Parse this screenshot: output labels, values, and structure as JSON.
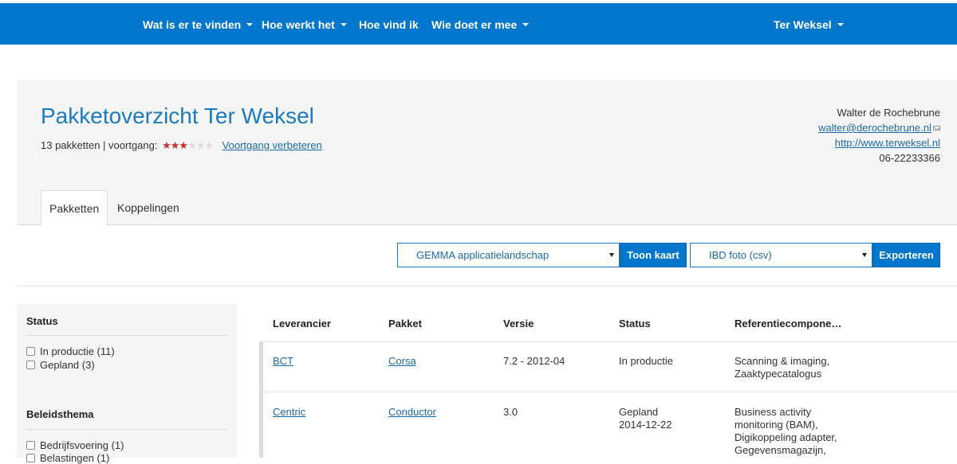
{
  "nav": {
    "items": [
      "Wat is er te vinden",
      "Hoe werkt het",
      "Hoe vind ik",
      "Wie doet er mee"
    ],
    "user_menu": "Ter Weksel"
  },
  "header": {
    "title": "Pakketoverzicht Ter Weksel",
    "summary": "13 pakketten | voortgang:",
    "progress_stars": {
      "filled": 3,
      "total": 6
    },
    "improve_link": "Voortgang verbeteren"
  },
  "contact": {
    "name": "Walter de Rochebrune",
    "email": "walter@derochebrune.nl",
    "website": "http://www.terweksel.nl",
    "phone": "06-22233366"
  },
  "tabs": [
    "Pakketten",
    "Koppelingen"
  ],
  "toolbar": {
    "map_select_value": "GEMMA applicatielandschap",
    "map_button": "Toon kaart",
    "export_select_value": "IBD foto (csv)",
    "export_button": "Exporteren"
  },
  "filters": {
    "status": {
      "title": "Status",
      "options": [
        "In productie (11)",
        "Gepland (3)"
      ]
    },
    "beleidsthema": {
      "title": "Beleidsthema",
      "options": [
        "Bedrijfsvoering (1)",
        "Belastingen (1)"
      ]
    }
  },
  "table": {
    "headers": [
      "Leverancier",
      "Pakket",
      "Versie",
      "Status",
      "Referentiecompone…"
    ],
    "rows": [
      {
        "leverancier": "BCT",
        "pakket": "Corsa",
        "versie": "7.2 - 2012-04",
        "status": [
          "In productie"
        ],
        "referentie": [
          "Scanning & imaging,",
          "Zaaktypecatalogus"
        ]
      },
      {
        "leverancier": "Centric",
        "pakket": "Conductor",
        "versie": "3.0",
        "status": [
          "Gepland",
          "2014-12-22"
        ],
        "referentie": [
          "Business activity",
          "monitoring (BAM),",
          "Digikoppeling adapter,",
          "Gegevensmagazijn,"
        ]
      }
    ]
  },
  "colors": {
    "navbar": "#0077cc",
    "title": "#1a7bc3",
    "link": "#1a6aa8",
    "star_filled": "#c9302c",
    "star_empty": "#dcdcdc"
  }
}
